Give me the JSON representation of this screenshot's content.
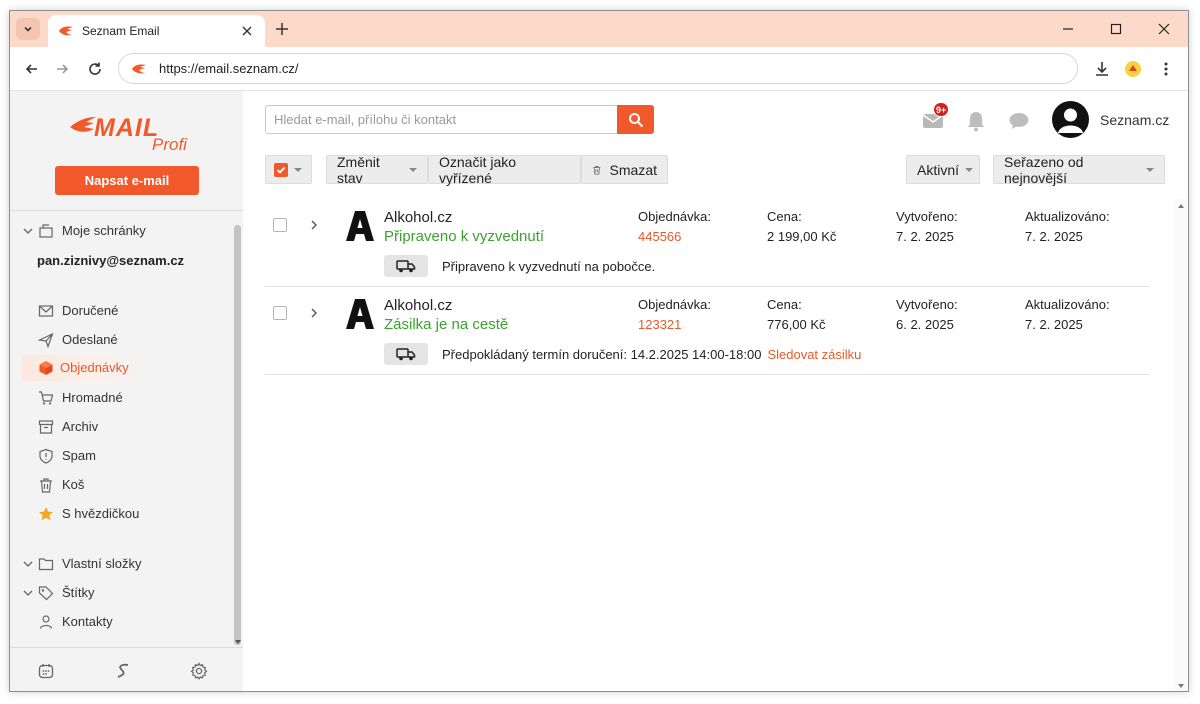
{
  "browser": {
    "tab_title": "Seznam Email",
    "url": "https://email.seznam.cz/"
  },
  "colors": {
    "brand": "#f2592a",
    "status_green": "#39a32d",
    "link_orange": "#e9582a",
    "tab_strip": "#fcd9c8"
  },
  "sidebar": {
    "logo_sub": "Profi",
    "compose_label": "Napsat e-mail",
    "mailboxes_label": "Moje schránky",
    "account_email": "pan.ziznivy@seznam.cz",
    "folders": [
      {
        "label": "Doručené",
        "icon": "inbox-icon"
      },
      {
        "label": "Odeslané",
        "icon": "send-icon"
      },
      {
        "label": "Objednávky",
        "icon": "package-icon"
      },
      {
        "label": "Hromadné",
        "icon": "cart-icon"
      },
      {
        "label": "Archiv",
        "icon": "archive-icon"
      },
      {
        "label": "Spam",
        "icon": "shield-icon"
      },
      {
        "label": "Koš",
        "icon": "trash-icon"
      },
      {
        "label": "S hvězdičkou",
        "icon": "star-icon"
      }
    ],
    "custom_folders_label": "Vlastní složky",
    "tags_label": "Štítky",
    "contacts_label": "Kontakty"
  },
  "header": {
    "search_placeholder": "Hledat e-mail, přílohu či kontakt",
    "badge": "9+",
    "account_name": "Seznam.cz"
  },
  "toolbar": {
    "change_state": "Změnit stav",
    "mark_done": "Označit jako vyřízené",
    "delete": "Smazat",
    "active_filter": "Aktivní",
    "sort": "Seřazeno od nejnovější"
  },
  "orders": [
    {
      "shop": "Alkohol.cz",
      "status": "Připraveno k vyzvednutí",
      "order_label": "Objednávka:",
      "order_no": "445566",
      "price_label": "Cena:",
      "price": "2 199,00 Kč",
      "created_label": "Vytvořeno:",
      "created": "7. 2. 2025",
      "updated_label": "Aktualizováno:",
      "updated": "7. 2. 2025",
      "delivery_text": "Připraveno k vyzvednutí na pobočce.",
      "track_label": ""
    },
    {
      "shop": "Alkohol.cz",
      "status": "Zásilka je na cestě",
      "order_label": "Objednávka:",
      "order_no": "123321",
      "price_label": "Cena:",
      "price": "776,00 Kč",
      "created_label": "Vytvořeno:",
      "created": "6. 2. 2025",
      "updated_label": "Aktualizováno:",
      "updated": "7. 2. 2025",
      "delivery_text": "Předpokládaný termín doručení: 14.2.2025 14:00-18:00",
      "track_label": "Sledovat zásilku"
    }
  ]
}
